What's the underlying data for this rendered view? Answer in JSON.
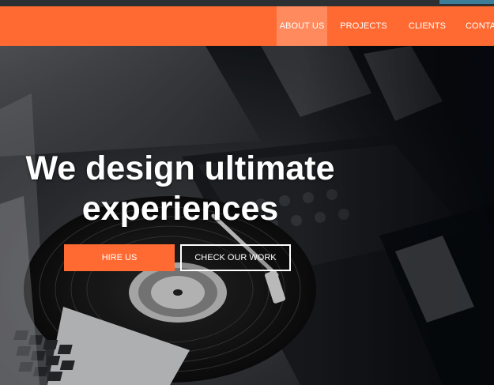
{
  "nav": {
    "items": [
      {
        "label": "ABOUT US",
        "active": true
      },
      {
        "label": "PROJECTS",
        "active": false
      },
      {
        "label": "CLIENTS",
        "active": false
      },
      {
        "label": "CONTACT",
        "active": false
      }
    ]
  },
  "hero": {
    "headline": "We design ultimate experiences",
    "hire_button": "HIRE US",
    "work_button": "CHECK OUR WORK"
  },
  "colors": {
    "accent": "#ff6a32",
    "accent_active": "#ff8a5e",
    "top_strip": "#2d3033"
  }
}
